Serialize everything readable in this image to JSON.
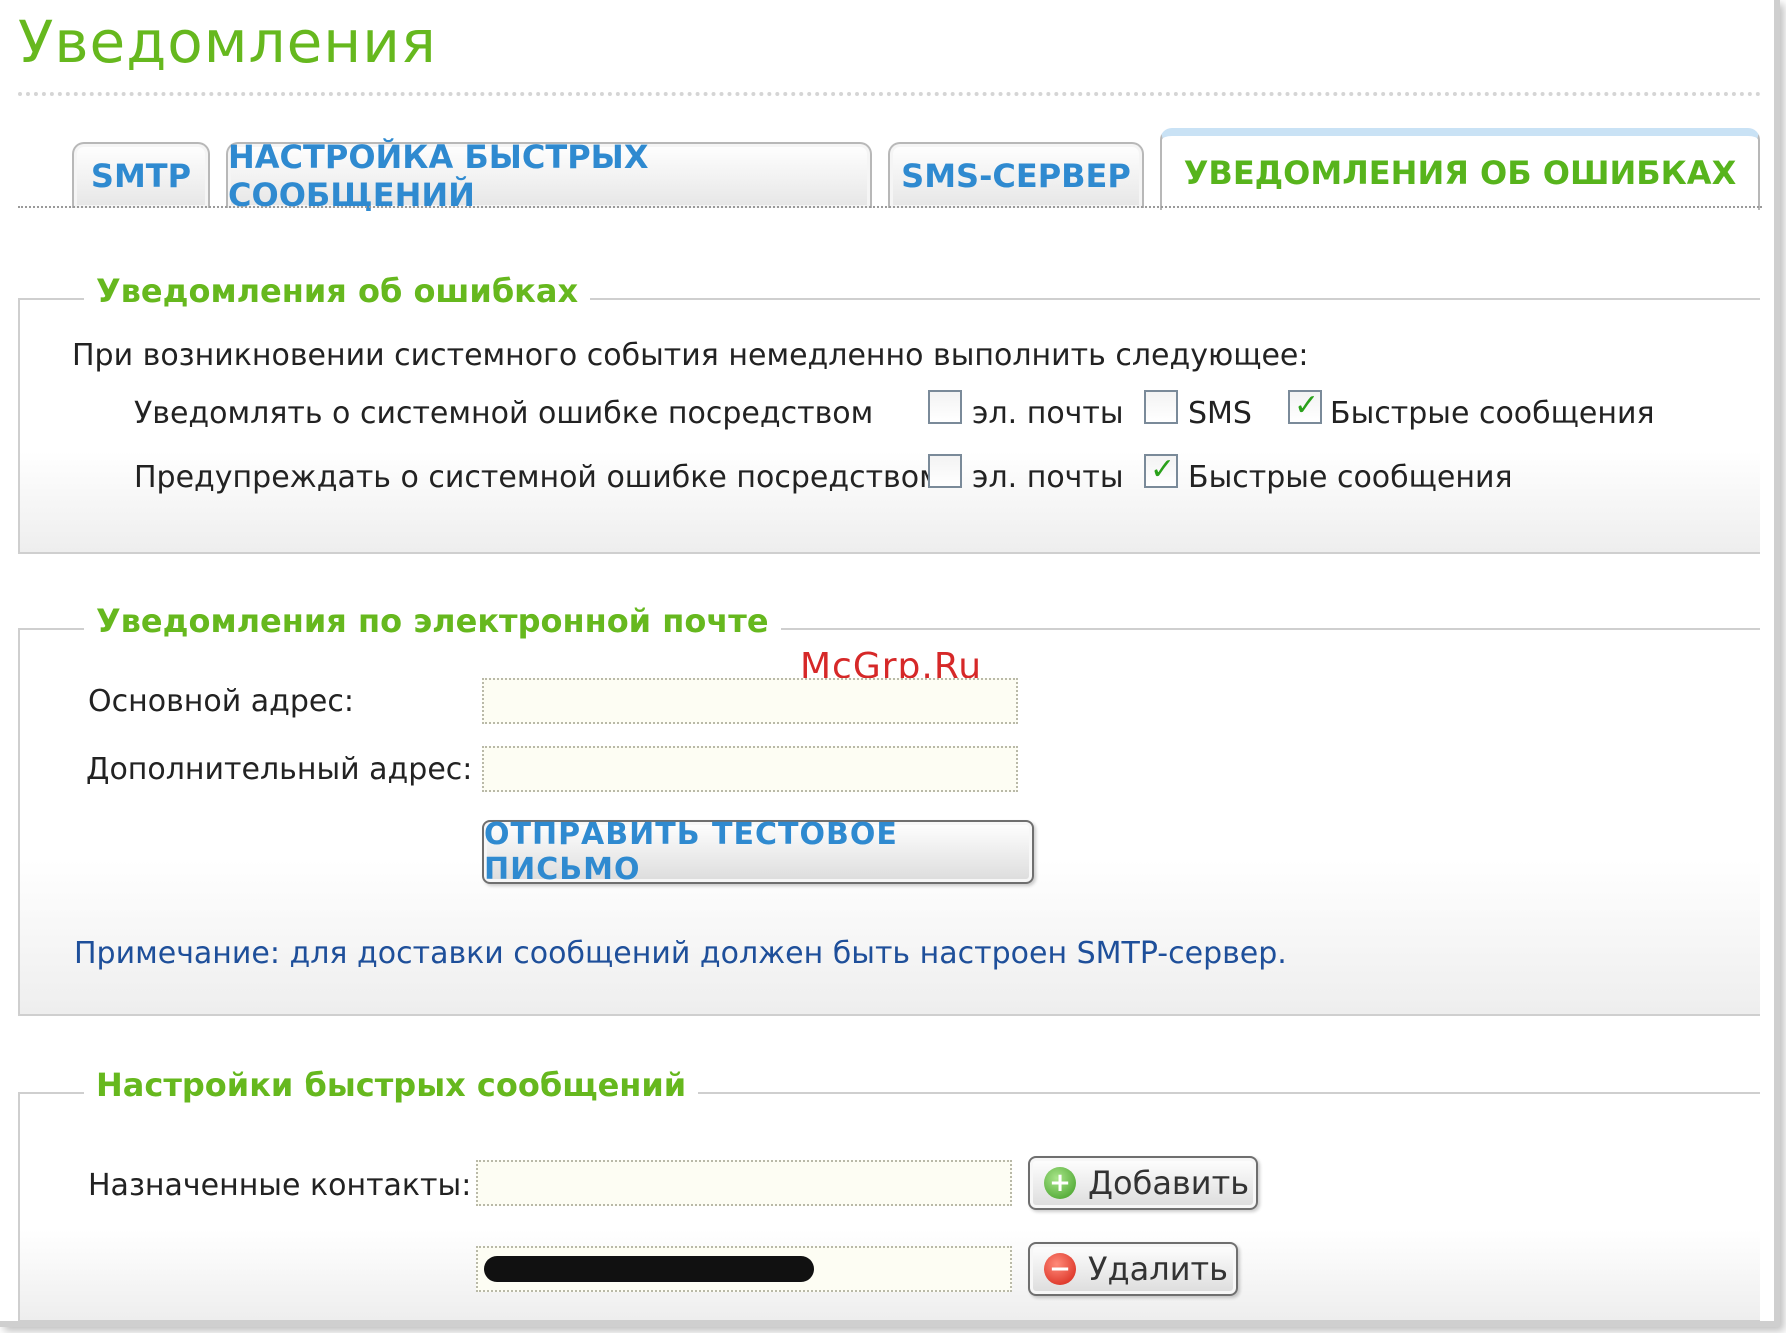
{
  "page": {
    "title": "Уведомления"
  },
  "tabs": [
    {
      "label": "SMTP",
      "active": false
    },
    {
      "label": "НАСТРОЙКА БЫСТРЫХ СООБЩЕНИЙ",
      "active": false
    },
    {
      "label": "SMS-СЕРВЕР",
      "active": false
    },
    {
      "label": "УВЕДОМЛЕНИЯ ОБ ОШИБКАХ",
      "active": true
    }
  ],
  "errors": {
    "legend": "Уведомления об ошибках",
    "intro": "При возникновении системного события немедленно выполнить следующее:",
    "notify_label": "Уведомлять о системной ошибке посредством",
    "warn_label": "Предупреждать о системной ошибке посредством",
    "options": {
      "email": "эл. почты",
      "sms": "SMS",
      "im": "Быстрые сообщения"
    },
    "notify_checked": {
      "email": false,
      "sms": false,
      "im": true
    },
    "warn_checked": {
      "email": false,
      "im": true
    }
  },
  "email": {
    "legend": "Уведомления по электронной почте",
    "primary_label": "Основной адрес:",
    "primary_value": "",
    "secondary_label": "Дополнительный адрес:",
    "secondary_value": "",
    "test_button": "ОТПРАВИТЬ ТЕСТОВОЕ ПИСЬМО",
    "note": "Примечание: для доставки сообщений должен быть настроен SMTP-сервер."
  },
  "im": {
    "legend": "Настройки быстрых сообщений",
    "contacts_label": "Назначенные контакты:",
    "contact_input_value": "",
    "add_button": "Добавить",
    "remove_button": "Удалить"
  },
  "watermark": "McGrp.Ru",
  "colors": {
    "accent_green": "#66b81e",
    "accent_blue": "#2f8ad0",
    "note_blue": "#1e4f9a"
  },
  "icons": {
    "add": "plus-circle-icon",
    "remove": "minus-circle-icon",
    "check": "checkmark-icon"
  }
}
